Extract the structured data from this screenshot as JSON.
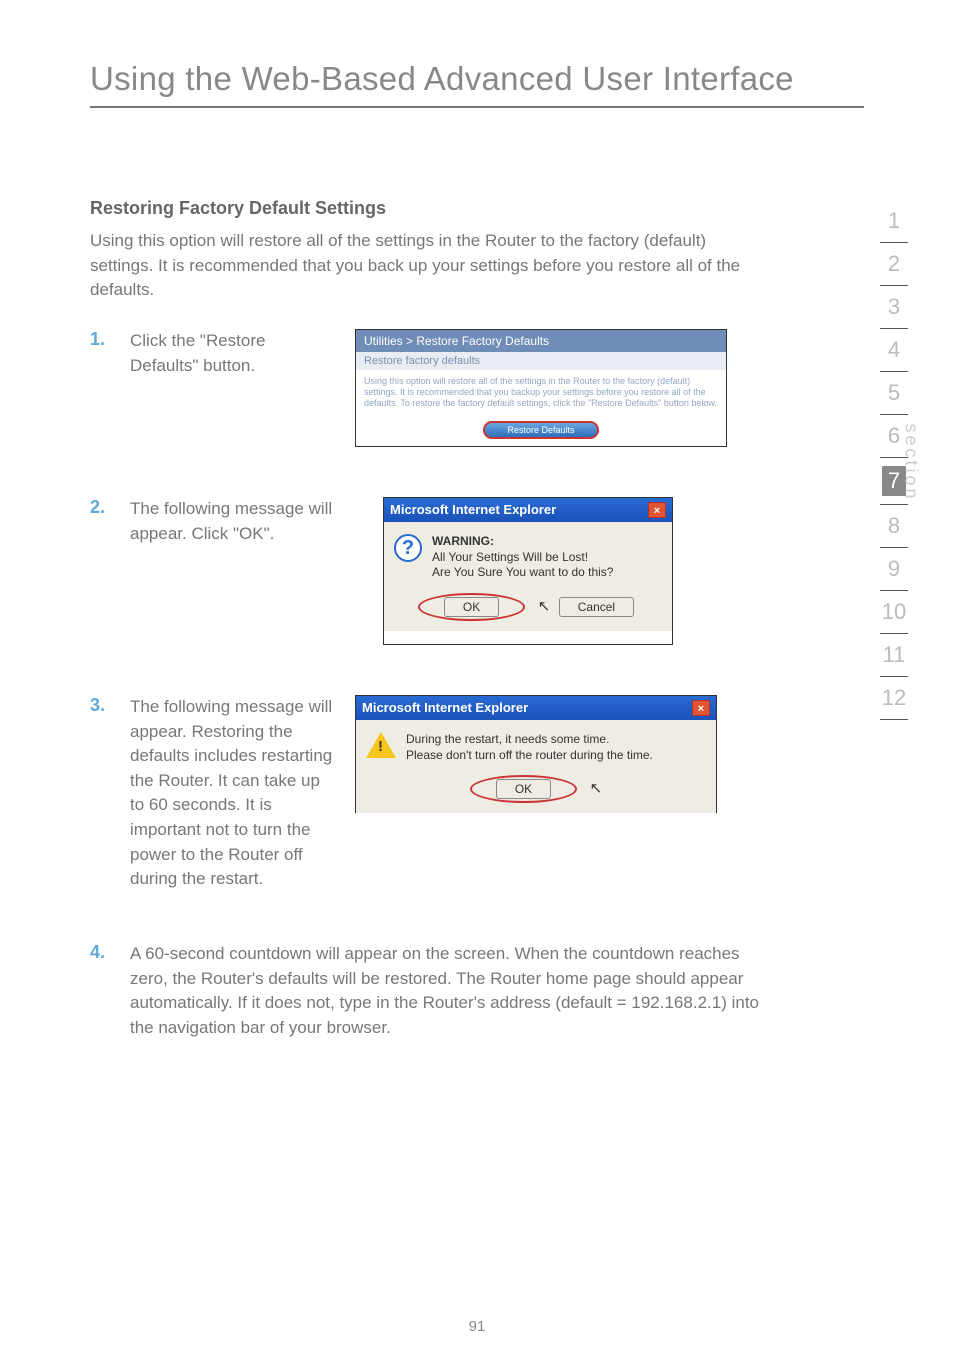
{
  "page_title": "Using the Web-Based Advanced User Interface",
  "section_heading": "Restoring Factory Default Settings",
  "intro": "Using this option will restore all of the settings in the Router to the factory (default) settings. It is recommended that you back up your settings before you restore all of the defaults.",
  "steps": {
    "s1": {
      "num": "1.",
      "text": "Click the \"Restore Defaults\" button."
    },
    "s2": {
      "num": "2.",
      "text": "The following message will appear. Click \"OK\"."
    },
    "s3": {
      "num": "3.",
      "text": "The following message will appear. Restoring the defaults includes restarting the Router. It can take up to 60 seconds. It is important not to turn the power to the Router off during the restart."
    },
    "s4": {
      "num": "4.",
      "text": "A 60-second countdown will appear on the screen. When the countdown reaches zero, the Router's defaults will be restored. The Router home page should appear automatically. If it does not, type in the Router's address (default = 192.168.2.1) into the navigation bar of your browser."
    }
  },
  "util": {
    "header": "Utilities > Restore Factory Defaults",
    "sub": "Restore factory defaults",
    "body": "Using this option will restore all of the settings in the Router to the factory (default) settings. It is recommended that you backup your settings before you restore all of the defaults. To restore the factory default settings, click the \"Restore Defaults\" button below.",
    "button": "Restore Defaults"
  },
  "dlg1": {
    "title": "Microsoft Internet Explorer",
    "warn": "WARNING:",
    "line1": "All Your Settings Will be Lost!",
    "line2": "Are You Sure You want to do this?",
    "ok": "OK",
    "cancel": "Cancel"
  },
  "dlg2": {
    "title": "Microsoft Internet Explorer",
    "line1": "During the restart, it needs some time.",
    "line2": "Please don't turn off the router during the time.",
    "ok": "OK"
  },
  "sidenav": [
    "1",
    "2",
    "3",
    "4",
    "5",
    "6",
    "7",
    "8",
    "9",
    "10",
    "11",
    "12"
  ],
  "sidenav_active_index": 6,
  "sidenav_label": "section",
  "footer": "91"
}
